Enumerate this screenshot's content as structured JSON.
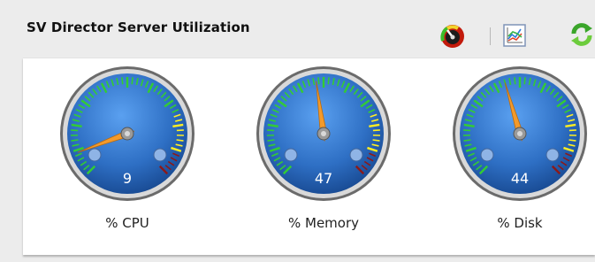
{
  "widget": {
    "title": "SV Director Server Utilization",
    "toolbar": {
      "icons": [
        "gauge-view-icon",
        "chart-view-icon",
        "refresh-icon"
      ]
    }
  },
  "gauges": [
    {
      "label": "% CPU",
      "value": 9
    },
    {
      "label": "% Memory",
      "value": 47
    },
    {
      "label": "% Disk",
      "value": 44
    }
  ],
  "gauge_scale": {
    "min": 0,
    "max": 100
  },
  "colors": {
    "dial_face": "#2e6fc4",
    "needle": "#f39a2b",
    "zone_green": "#33cc33",
    "zone_yellow": "#ffee22",
    "zone_red": "#8b1a1a"
  }
}
